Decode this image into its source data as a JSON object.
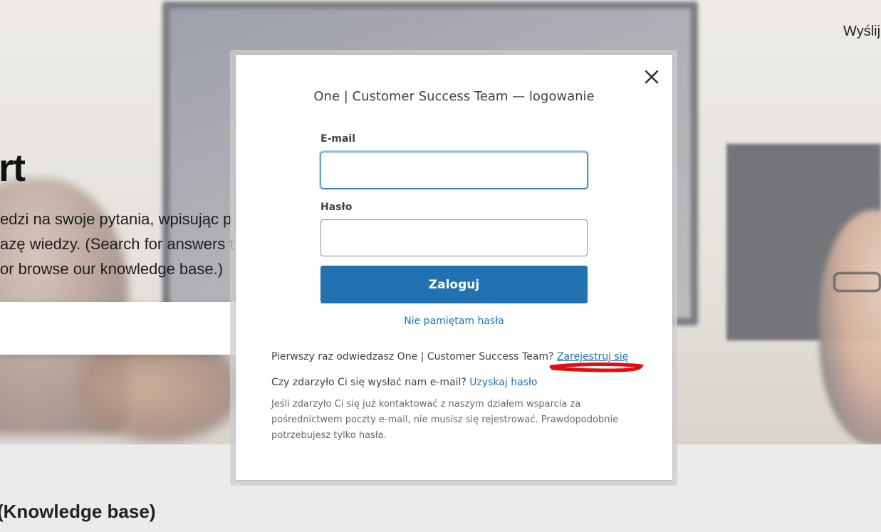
{
  "background": {
    "top_link": "Wyślij",
    "hero_title": "rt",
    "hero_lines": [
      "edzi na swoje pytania, wpisując p",
      "azę wiedzy. (Search for answers t",
      "or browse our knowledge base.)"
    ],
    "kb_heading": "(Knowledge base)"
  },
  "modal": {
    "title": "One | Customer Success Team — logowanie",
    "email_label": "E-mail",
    "email_value": "",
    "password_label": "Hasło",
    "password_value": "",
    "login_button": "Zaloguj",
    "forgot_link": "Nie pamiętam hasła",
    "first_visit_text": "Pierwszy raz odwiedzasz One | Customer Success Team?",
    "register_link": "Zarejestruj się",
    "emailed_text": "Czy zdarzyło Ci się wysłać nam e-mail?",
    "get_password_link": "Uzyskaj hasło",
    "info_text": "Jeśli zdarzyło Ci się już kontaktować z naszym działem wsparcia za pośrednictwem poczty e-mail, nie musisz się rejestrować. Prawdopodobnie potrzebujesz tylko hasła."
  },
  "colors": {
    "accent": "#2271b1",
    "annotation": "#e01010"
  }
}
